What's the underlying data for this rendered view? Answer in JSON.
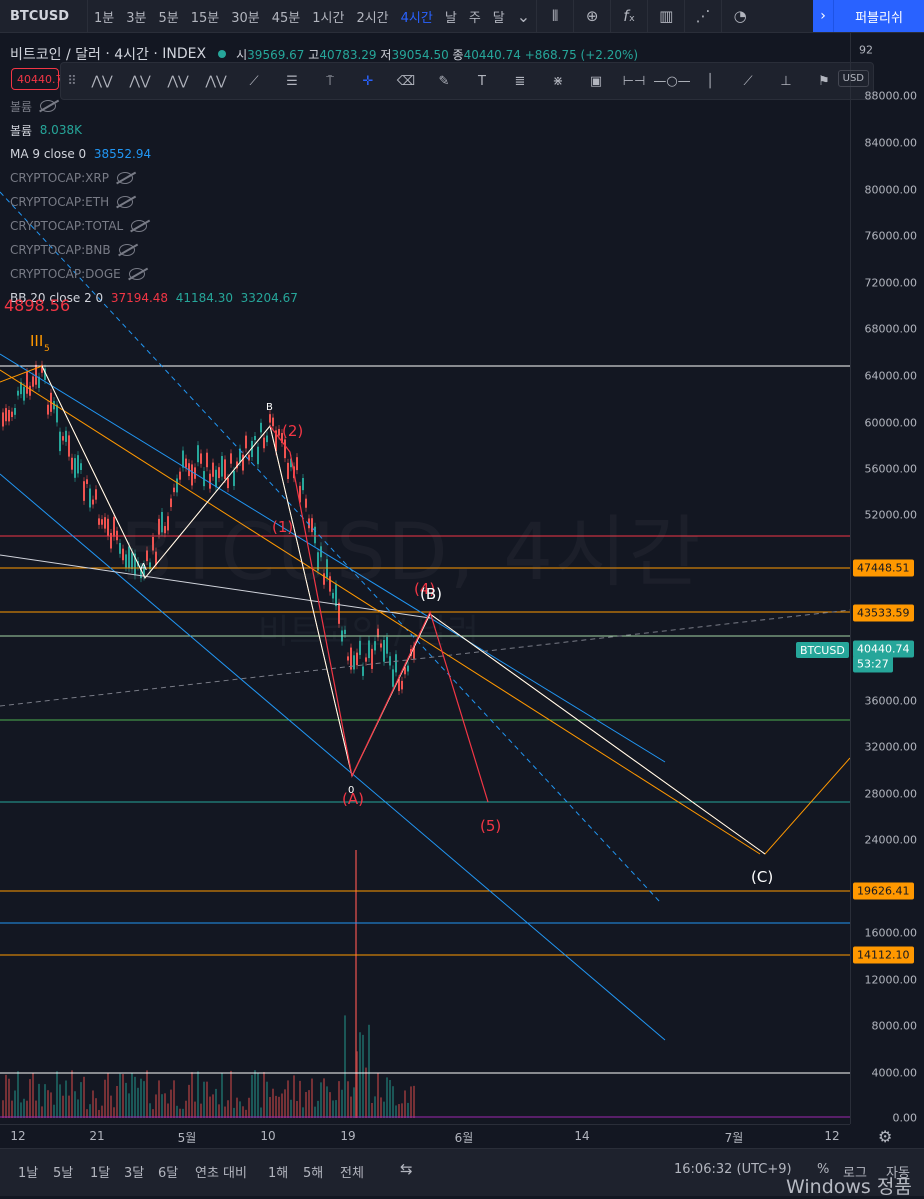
{
  "toolbar": {
    "symbol": "BTCUSD",
    "intervals": [
      "1분",
      "3분",
      "5분",
      "15분",
      "30분",
      "45분",
      "1시간",
      "2시간",
      "4시간",
      "날",
      "주",
      "달"
    ],
    "active_interval": "4시간",
    "publish_label": "퍼블리쉬"
  },
  "legend": {
    "title": "비트코인 / 달러",
    "interval": "4시간",
    "exchange": "INDEX",
    "open_label": "시",
    "open": "39569.67",
    "high_label": "고",
    "high": "40783.29",
    "low_label": "저",
    "low": "39054.50",
    "close_label": "종",
    "close": "40440.74",
    "change": "+868.75 (+2.20%)",
    "price_box": "40440.7",
    "vol_hidden": "볼륨",
    "vol_label": "볼륨",
    "vol_value": "8.038K",
    "ma_label": "MA 9 close 0",
    "ma_value": "38552.94",
    "hidden_indicators": [
      "CRYPTOCAP:XRP",
      "CRYPTOCAP:ETH",
      "CRYPTOCAP:TOTAL",
      "CRYPTOCAP:BNB",
      "CRYPTOCAP:DOGE"
    ],
    "bb_label": "BB 20 close 2 0",
    "bb_basis": "37194.48",
    "bb_upper": "41184.30",
    "bb_lower": "33204.67"
  },
  "watermark": {
    "main": "BTCUSD, 4시간",
    "sub": "비트코인 / 달러"
  },
  "price_axis": {
    "currency": "USD",
    "top_partial": "92",
    "ticks": [
      "88000.00",
      "84000.00",
      "80000.00",
      "76000.00",
      "72000.00",
      "68000.00",
      "64000.00",
      "60000.00",
      "56000.00",
      "52000.00",
      "36000.00",
      "32000.00",
      "28000.00",
      "24000.00",
      "16000.00",
      "12000.00",
      "8000.00",
      "4000.00",
      "0.00"
    ],
    "labels": [
      {
        "text": "47448.51",
        "color": "#ff9800"
      },
      {
        "text": "43533.59",
        "color": "#ff9800"
      },
      {
        "text": "40440.74",
        "color": "#26a69a"
      },
      {
        "text": "53:27",
        "color": "#26a69a"
      },
      {
        "text": "19626.41",
        "color": "#ff9800"
      },
      {
        "text": "14112.10",
        "color": "#ff9800"
      }
    ],
    "symbol_tag": "BTCUSD"
  },
  "time_axis": {
    "ticks": [
      "12",
      "21",
      "5월",
      "10",
      "19",
      "6월",
      "14",
      "7월",
      "12"
    ]
  },
  "chart_annotations": {
    "wave_top": "III",
    "wave_top_sub": "5",
    "top_price": "4898.56",
    "A": "A",
    "B": "B",
    "w1": "(1)",
    "w2": "(2)",
    "w4": "(4)",
    "w5": "(5)",
    "wA": "(A)",
    "wB": "(B)",
    "wC": "(C)",
    "wA_small": "0"
  },
  "bottom": {
    "ranges": [
      "1날",
      "5날",
      "1달",
      "3달",
      "6달",
      "연초 대비",
      "1해",
      "5해",
      "전체"
    ],
    "time": "16:06:32 (UTC+9)",
    "percent": "%",
    "log": "로그",
    "auto": "자동",
    "windows_watermark": "Windows 정품"
  },
  "colors": {
    "bg": "#131722",
    "orange": "#ff9800",
    "teal": "#26a69a",
    "red": "#f23645",
    "blue": "#2196f3",
    "accent": "#2962ff"
  }
}
